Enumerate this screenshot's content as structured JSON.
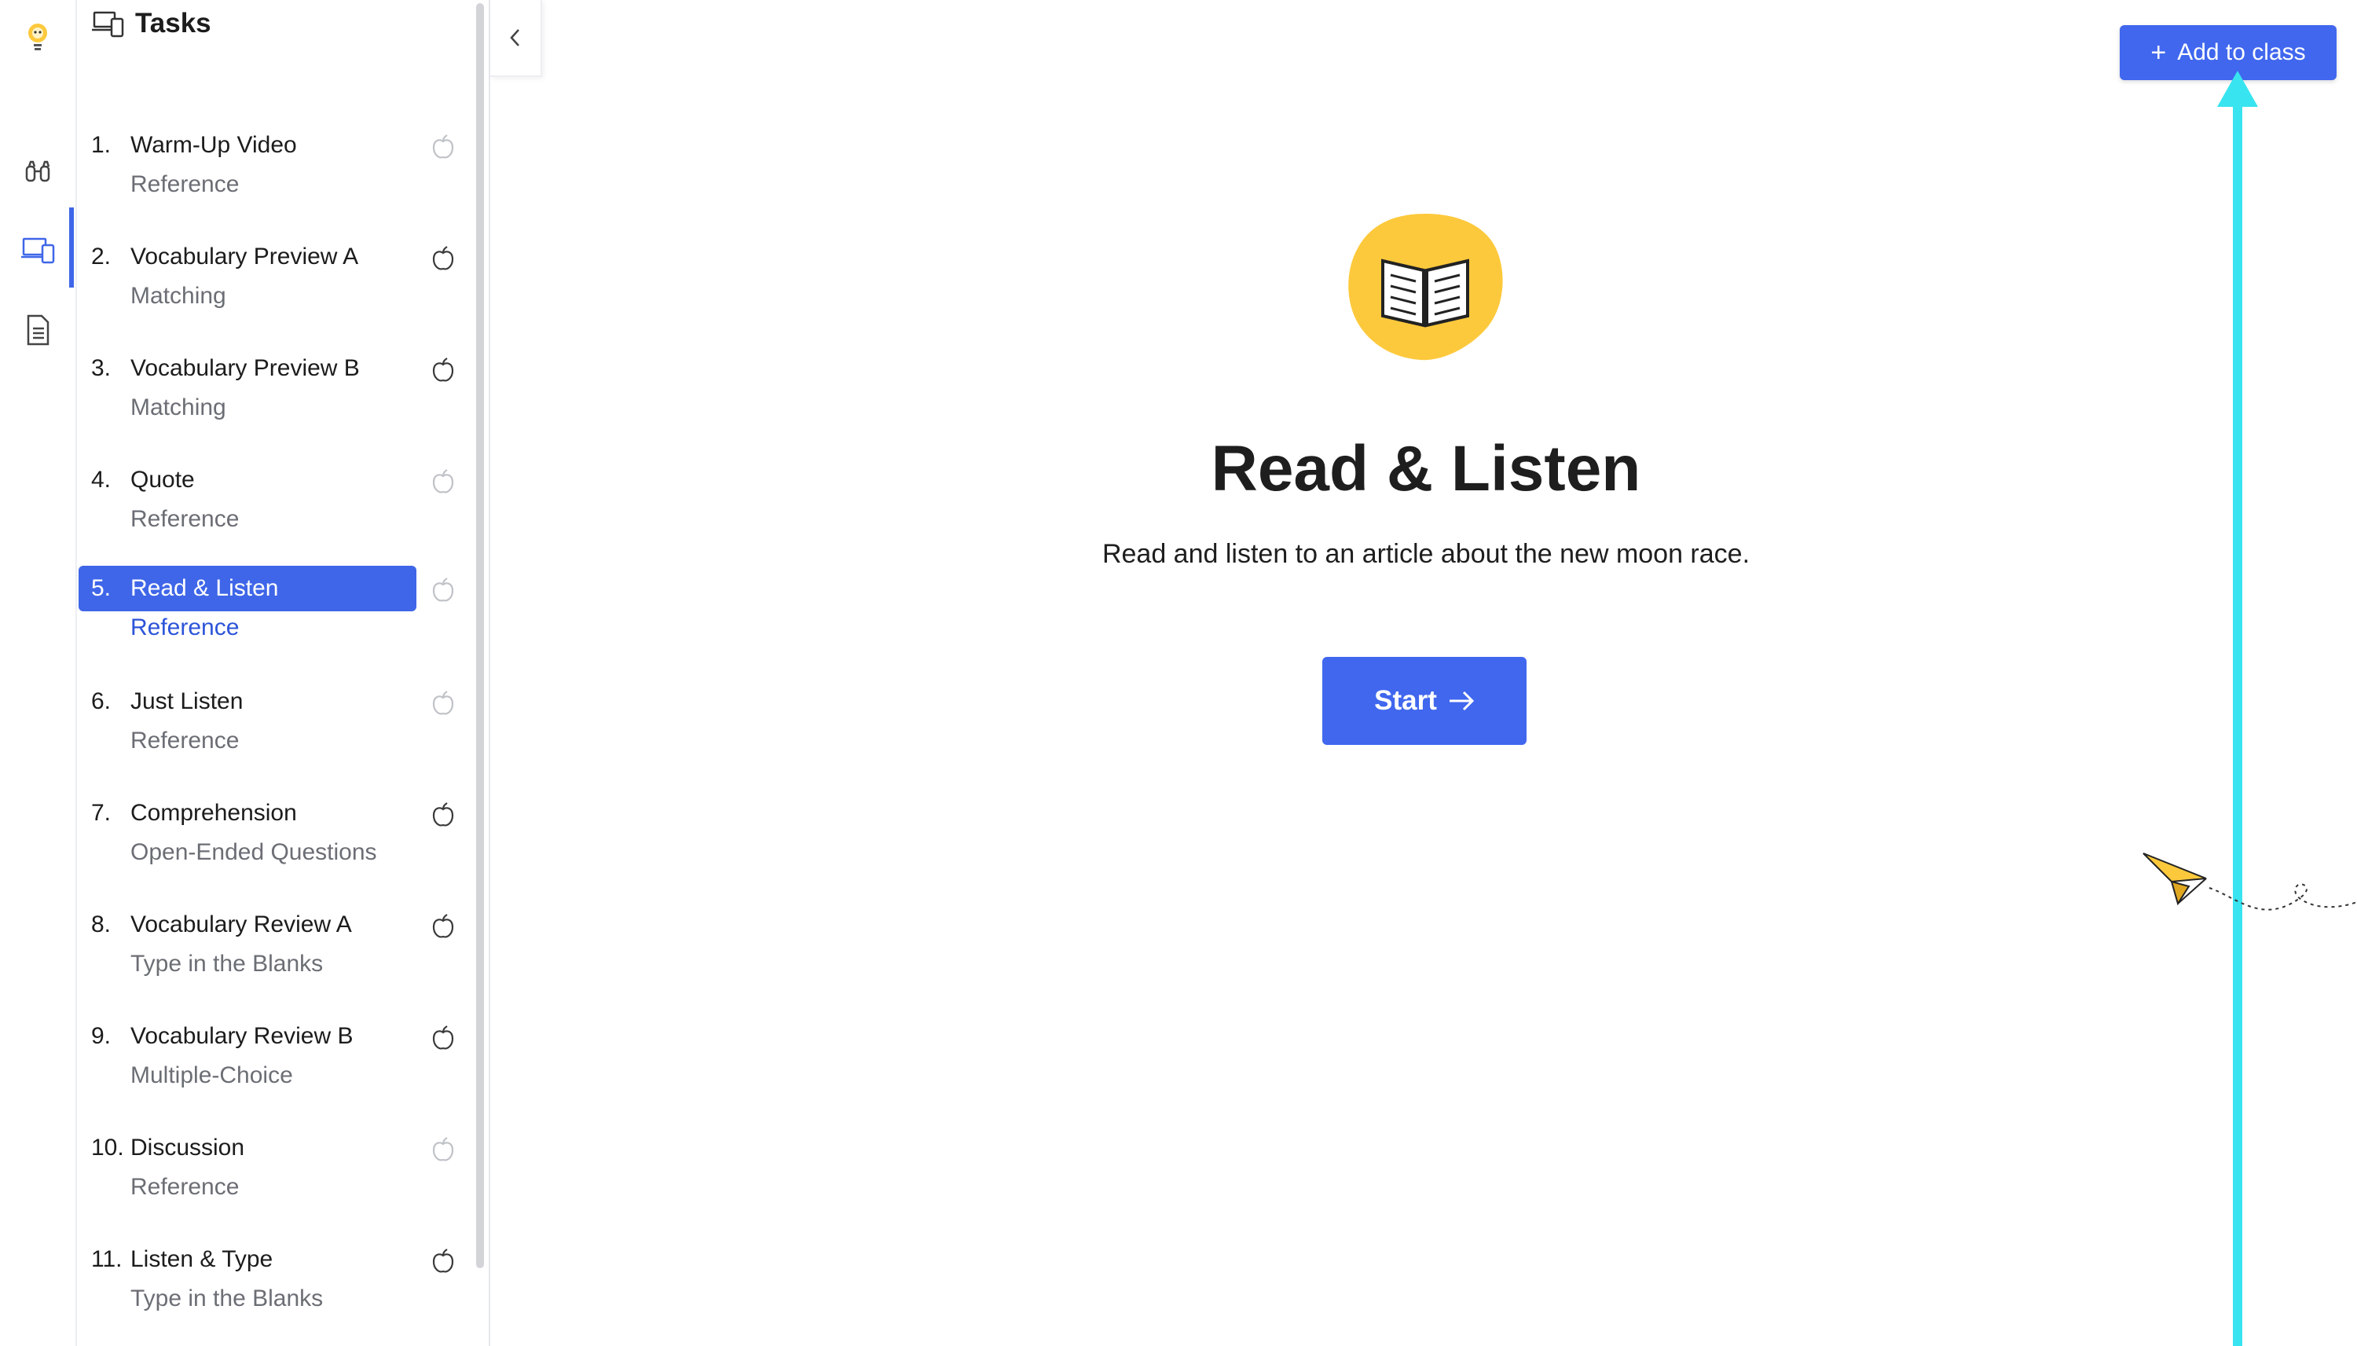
{
  "panel": {
    "title": "Tasks",
    "tasks": [
      {
        "num": "1.",
        "title": "Warm-Up Video",
        "type": "Reference",
        "icon": "apple-outline-icon"
      },
      {
        "num": "2.",
        "title": "Vocabulary Preview A",
        "type": "Matching",
        "icon": "apple-icon"
      },
      {
        "num": "3.",
        "title": "Vocabulary Preview B",
        "type": "Matching",
        "icon": "apple-icon"
      },
      {
        "num": "4.",
        "title": "Quote",
        "type": "Reference",
        "icon": "apple-outline-icon"
      },
      {
        "num": "5.",
        "title": "Read & Listen",
        "type": "Reference",
        "icon": "apple-outline-icon"
      },
      {
        "num": "6.",
        "title": "Just Listen",
        "type": "Reference",
        "icon": "apple-outline-icon"
      },
      {
        "num": "7.",
        "title": "Comprehension",
        "type": "Open-Ended Questions",
        "icon": "apple-icon"
      },
      {
        "num": "8.",
        "title": "Vocabulary Review A",
        "type": "Type in the Blanks",
        "icon": "apple-icon"
      },
      {
        "num": "9.",
        "title": "Vocabulary Review B",
        "type": "Multiple-Choice",
        "icon": "apple-icon"
      },
      {
        "num": "10.",
        "title": "Discussion",
        "type": "Reference",
        "icon": "apple-outline-icon"
      },
      {
        "num": "11.",
        "title": "Listen & Type",
        "type": "Type in the Blanks",
        "icon": "apple-icon"
      }
    ]
  },
  "main": {
    "add_to_class": "Add to class",
    "heading": "Read & Listen",
    "description": "Read and listen to an article about the new moon race.",
    "start_label": "Start"
  },
  "colors": {
    "accent": "#3f66e8",
    "book_yellow": "#fdc93c",
    "cyan_marker": "#38e4ef"
  }
}
